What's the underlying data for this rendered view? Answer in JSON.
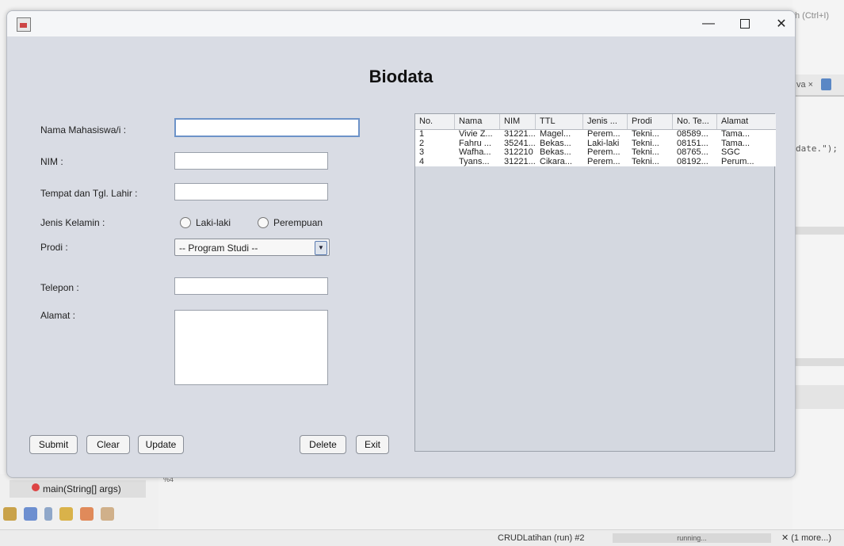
{
  "window": {
    "title": "",
    "minimize": "—",
    "close": "✕"
  },
  "form": {
    "title": "Biodata",
    "labels": {
      "nama": "Nama Mahasiswa/i :",
      "nim": "NIM :",
      "ttl": "Tempat dan Tgl. Lahir :",
      "jenis_kelamin": "Jenis Kelamin :",
      "prodi": "Prodi :",
      "telepon": "Telepon :",
      "alamat": "Alamat :"
    },
    "values": {
      "nama": "",
      "nim": "",
      "ttl": "",
      "telepon": "",
      "alamat": ""
    },
    "radio": {
      "male": "Laki-laki",
      "female": "Perempuan"
    },
    "prodi_selected": "-- Program Studi --",
    "buttons": {
      "submit": "Submit",
      "clear": "Clear",
      "update": "Update",
      "delete": "Delete",
      "exit": "Exit"
    }
  },
  "table": {
    "columns": [
      "No.",
      "Nama",
      "NIM",
      "TTL",
      "Jenis ...",
      "Prodi",
      "No. Te...",
      "Alamat"
    ],
    "rows": [
      [
        "1",
        "Vivie Z...",
        "31221...",
        "Magel...",
        "Perem...",
        "Tekni...",
        "08589...",
        "Tama..."
      ],
      [
        "2",
        "Fahru ...",
        "35241...",
        "Bekas...",
        "Laki-laki",
        "Tekni...",
        "08151...",
        "Tama..."
      ],
      [
        "3",
        "Wafha...",
        "312210",
        "Bekas...",
        "Perem...",
        "Tekni...",
        "08765...",
        "SGC"
      ],
      [
        "4",
        "Tyans...",
        "31221...",
        "Cikara...",
        "Perem...",
        "Tekni...",
        "08192...",
        "Perum..."
      ]
    ]
  },
  "ide": {
    "search_hint": "h (Ctrl+I)",
    "tab_label": "va ×",
    "code_snippet": "date.\");",
    "nav_item": "main(String[] args)",
    "small_code": "%4",
    "status": {
      "run": "CRUDLatihan (run) #2",
      "progress": "running...",
      "more": "✕  (1 more...)"
    }
  }
}
